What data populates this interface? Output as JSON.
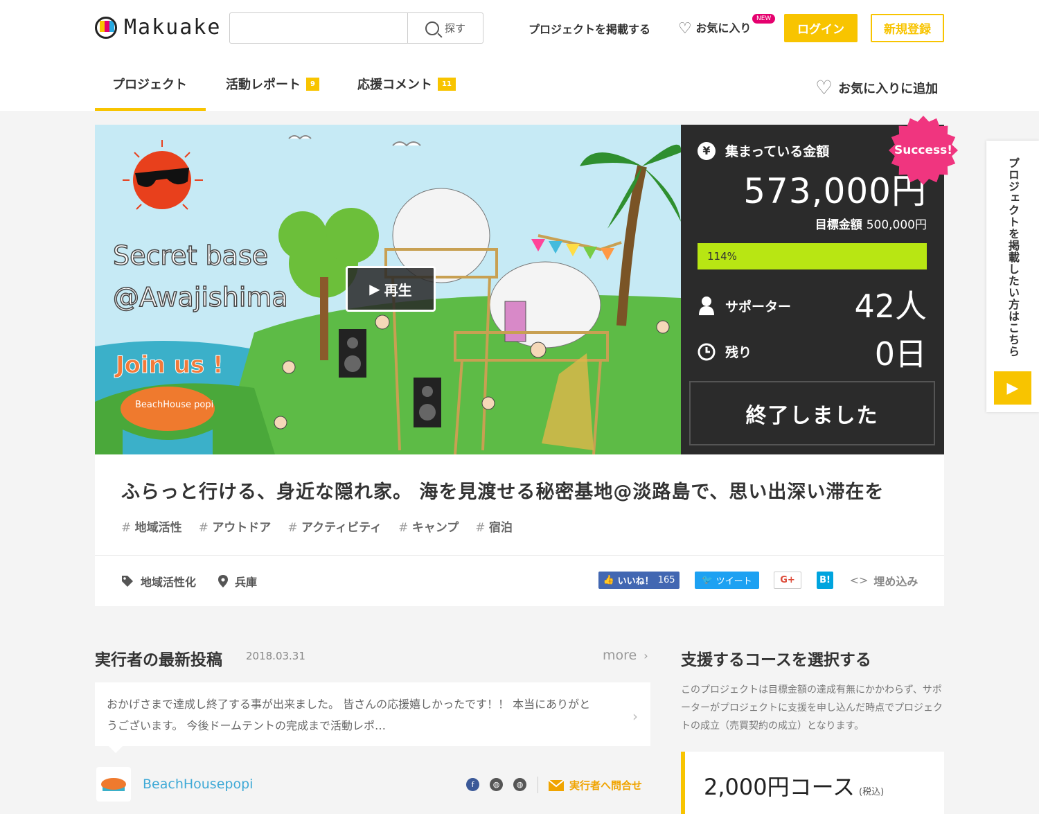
{
  "header": {
    "logo_text": "Makuake",
    "search_placeholder": "",
    "search_button": "探す",
    "post_project": "プロジェクトを掲載する",
    "favorites": "お気に入り",
    "new_badge": "NEW",
    "login": "ログイン",
    "signup": "新規登録"
  },
  "tabs": [
    {
      "label": "プロジェクト",
      "badge": ""
    },
    {
      "label": "活動レポート",
      "badge": "9"
    },
    {
      "label": "応援コメント",
      "badge": "11"
    }
  ],
  "add_favorite": "お気に入りに追加",
  "hero": {
    "play_label": "再生",
    "image_text": {
      "line1": "Secret base",
      "line2": "@Awajishima",
      "join": "Join us !",
      "sign": "BeachHouse popi"
    }
  },
  "funding": {
    "raised_label": "集まっている金額",
    "raised_amount": "573,000円",
    "goal_label": "目標金額",
    "goal_amount": "500,000円",
    "percent_text": "114%",
    "percent_value": 114,
    "supporters_label": "サポーター",
    "supporters_value": "42人",
    "remaining_label": "残り",
    "remaining_value": "0日",
    "ended_button": "終了しました",
    "success_badge": "Success!"
  },
  "side_tab": {
    "text": "プロジェクトを掲載したい方はこちら"
  },
  "project": {
    "title": "ふらっと行ける、身近な隠れ家。 海を見渡せる秘密基地@淡路島で、思い出深い滞在を",
    "tags": [
      "地域活性",
      "アウトドア",
      "アクティビティ",
      "キャンプ",
      "宿泊"
    ],
    "category": "地域活性化",
    "location": "兵庫",
    "share": {
      "like": "いいね！",
      "like_count": "165",
      "tweet": "ツイート",
      "gplus": "G+",
      "hatena": "B!",
      "embed": "埋め込み"
    }
  },
  "latest_post": {
    "heading": "実行者の最新投稿",
    "date": "2018.03.31",
    "more": "more",
    "body_line1": "おかげさまで達成し終了する事が出来ました。 皆さんの応援嬉しかったです！！ 本当にありがと",
    "body_line2": "うございます。 今後ドームテントの完成まで活動レポ…",
    "owner_name": "BeachHousepopi",
    "contact": "実行者へ問合せ"
  },
  "courses": {
    "heading": "支援するコースを選択する",
    "description": "このプロジェクトは目標金額の達成有無にかかわらず、サポーターがプロジェクトに支援を申し込んだ時点でプロジェクトの成立（売買契約の成立）となります。",
    "first_course": "2,000円コース",
    "tax_note": "(税込)"
  },
  "colors": {
    "accent": "#f8c400",
    "progress": "#b8e613",
    "stats_bg": "#2b2b2b",
    "success": "#f0357f",
    "link": "#3ea9d6"
  }
}
